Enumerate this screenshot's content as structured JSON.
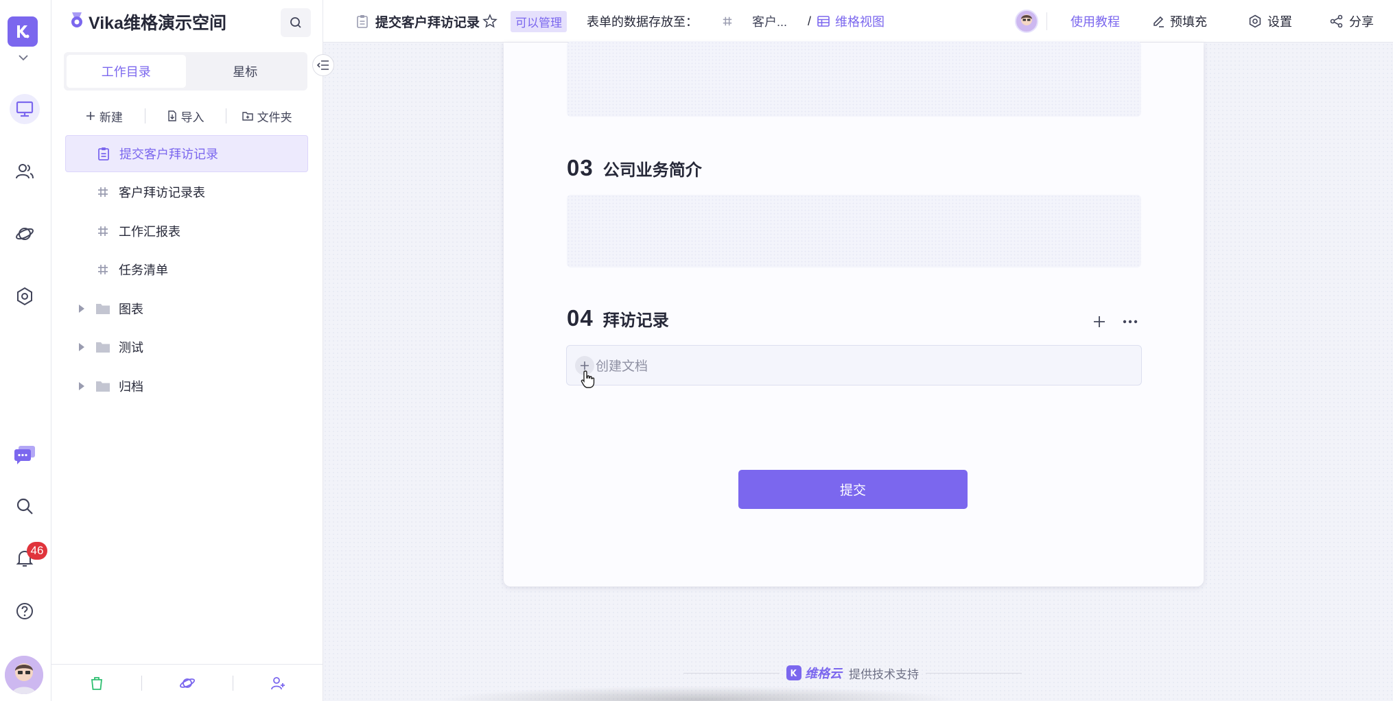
{
  "sidebar": {
    "space_name": "Vika维格演示空间",
    "tabs": [
      {
        "label": "工作目录",
        "active": true
      },
      {
        "label": "星标",
        "active": false
      }
    ],
    "tools": [
      {
        "label": "新建",
        "icon": "plus-icon"
      },
      {
        "label": "导入",
        "icon": "import-icon"
      },
      {
        "label": "文件夹",
        "icon": "folder-add-icon"
      }
    ],
    "nodes": [
      {
        "label": "提交客户拜访记录",
        "type": "form",
        "active": true
      },
      {
        "label": "客户拜访记录表",
        "type": "datasheet"
      },
      {
        "label": "工作汇报表",
        "type": "datasheet"
      },
      {
        "label": "任务清单",
        "type": "datasheet"
      },
      {
        "label": "图表",
        "type": "folder"
      },
      {
        "label": "测试",
        "type": "folder"
      },
      {
        "label": "归档",
        "type": "folder"
      }
    ]
  },
  "rail": {
    "notification_count": "46",
    "icons": [
      "workbench-icon",
      "contacts-icon",
      "explore-planet-icon",
      "settings-hex-icon",
      "chat-icon",
      "search-icon",
      "bell-icon",
      "help-icon"
    ]
  },
  "topbar": {
    "form_title": "提交客户拜访记录",
    "permission": "可以管理",
    "storage_label": "表单的数据存放至：",
    "datasheet_name": "客户...",
    "separator": "/",
    "view_name": "维格视图",
    "tutorial": "使用教程",
    "prefill": "预填充",
    "settings": "设置",
    "share": "分享"
  },
  "form": {
    "fields": [
      {
        "number": "03",
        "label": "公司业务简介"
      },
      {
        "number": "04",
        "label": "拜访记录"
      }
    ],
    "create_doc": "创建文档",
    "submit": "提交"
  },
  "footer": {
    "brand": "维格云",
    "powered": "提供技术支持"
  },
  "colors": {
    "accent": "#7b67ee",
    "badge": "#e0343c"
  }
}
